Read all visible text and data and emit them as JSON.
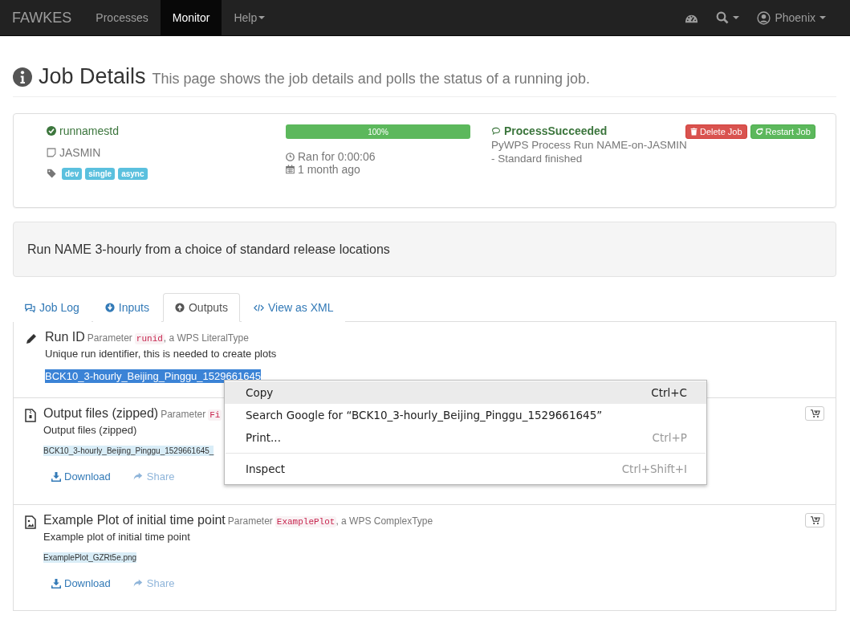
{
  "navbar": {
    "brand": "FAWKES",
    "items": [
      {
        "label": "Processes",
        "selected": false,
        "dropdown": false
      },
      {
        "label": "Monitor",
        "selected": true,
        "dropdown": false
      },
      {
        "label": "Help",
        "selected": false,
        "dropdown": true
      }
    ],
    "user": "Phoenix"
  },
  "header": {
    "title": "Job Details",
    "subtitle": "This page shows the job details and polls the status of a running job."
  },
  "job": {
    "name": "runnamestd",
    "service": "JASMIN",
    "tags": [
      "dev",
      "single",
      "async"
    ],
    "progress": {
      "level": 1,
      "label": "100%"
    },
    "duration": "Ran for 0:00:06",
    "created": "1 month ago",
    "status": "ProcessSucceeded",
    "message": "PyWPS Process Run NAME-on-JASMIN - Standard finished",
    "buttons": [
      {
        "label": "Delete Job",
        "kind": "danger"
      },
      {
        "label": "Restart Job",
        "kind": "success"
      }
    ]
  },
  "abstract": "Run NAME 3-hourly from a choice of standard release locations",
  "tabs": [
    {
      "label": "Job Log",
      "selected": false,
      "kind": "log"
    },
    {
      "label": "Inputs",
      "selected": false,
      "kind": "inputs"
    },
    {
      "label": "Outputs",
      "selected": true,
      "kind": "outputs"
    },
    {
      "label": "View as XML",
      "selected": false,
      "kind": "xml"
    }
  ],
  "outputs": [
    {
      "kind": "literal",
      "title": "Run ID",
      "param": "Parameter",
      "identifier": "runid",
      "type_text": ", a WPS LiteralType",
      "abstract": "Unique run identifier, this is needed to create plots",
      "value": "BCK10_3-hourly_Beijing_Pinggu_1529661645",
      "value_selected": true
    },
    {
      "kind": "archive",
      "title": "Output files (zipped)",
      "param": "Parameter",
      "identifier": "Fi",
      "abstract": "Output files (zipped)",
      "value": "BCK10_3-hourly_Beijing_Pinggu_1529661645_",
      "value_selected": false,
      "links": [
        "Download",
        "Share"
      ]
    },
    {
      "kind": "image",
      "title": "Example Plot of initial time point",
      "param": "Parameter",
      "identifier": "ExamplePlot",
      "type_text": ", a WPS ComplexType",
      "abstract": "Example plot of initial time point",
      "value": "ExamplePlot_GZRt5e.png",
      "value_selected": false,
      "links": [
        "Download",
        "Share"
      ]
    }
  ],
  "context_menu": {
    "groups": [
      [
        {
          "label": "Copy",
          "shortcut": "Ctrl+C",
          "selected": true
        },
        {
          "label": "Search Google for “BCK10_3-hourly_Beijing_Pinggu_1529661645”",
          "selected": false
        },
        {
          "label": "Print...",
          "shortcut": "Ctrl+P",
          "selected": false
        }
      ],
      [
        {
          "label": "Inspect",
          "shortcut": "Ctrl+Shift+I",
          "selected": false
        }
      ]
    ]
  }
}
